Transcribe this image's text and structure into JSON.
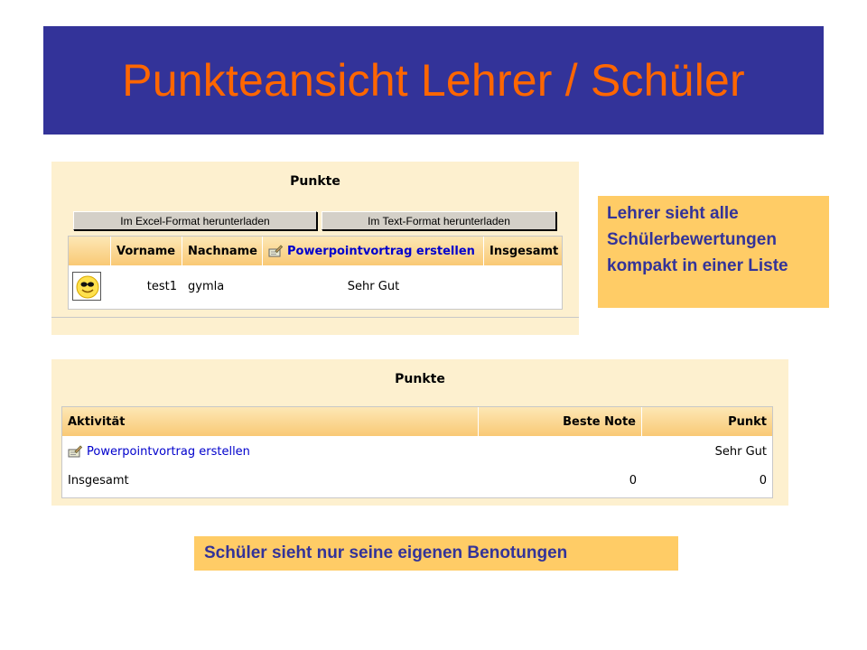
{
  "slide": {
    "title": "Punkteansicht Lehrer / Schüler"
  },
  "teacher_view": {
    "heading": "Punkte",
    "buttons": {
      "excel": "Im Excel-Format herunterladen",
      "text": "Im Text-Format herunterladen"
    },
    "columns": {
      "firstname": "Vorname",
      "lastname": "Nachname",
      "activity": "Powerpointvortrag erstellen",
      "total": "Insgesamt"
    },
    "rows": [
      {
        "firstname": "test1",
        "lastname": "gymla",
        "activity": "Sehr Gut",
        "total": ""
      }
    ]
  },
  "student_view": {
    "heading": "Punkte",
    "columns": {
      "activity": "Aktivität",
      "best": "Beste Note",
      "points": "Punkt"
    },
    "rows": [
      {
        "activity": "Powerpointvortrag erstellen",
        "best": "",
        "points": "Sehr Gut"
      },
      {
        "activity": "Insgesamt",
        "best": "0",
        "points": "0"
      }
    ]
  },
  "notes": {
    "teacher": "Lehrer sieht alle Schülerbewertungen kompakt in einer Liste",
    "student": "Schüler sieht nur seine eigenen Benotungen"
  },
  "icons": {
    "avatar": "smiley-sunglasses-icon",
    "activity": "assignment-icon"
  },
  "colors": {
    "title_bg": "#333399",
    "title_text": "#ff6600",
    "panel_bg": "#fdf0cf",
    "note_bg": "#ffcc66",
    "note_text": "#333399",
    "link": "#0000cc"
  }
}
